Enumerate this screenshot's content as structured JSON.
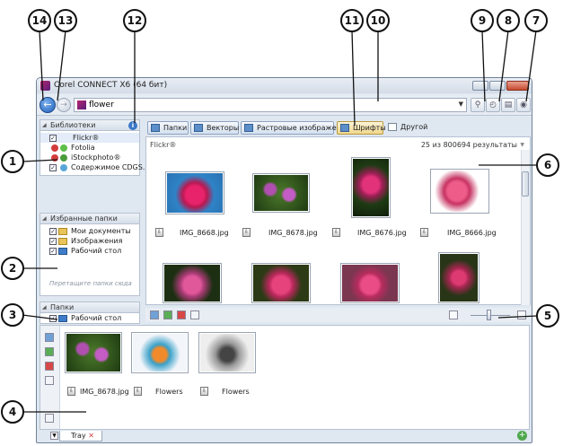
{
  "window": {
    "title": "Corel CONNECT X6 (64 бит)"
  },
  "address_bar": {
    "search_value": "flower"
  },
  "libraries": {
    "header": "Библиотеки",
    "items": [
      {
        "label": "Flickr®",
        "checked": true
      },
      {
        "label": "Fotolia",
        "checked": false
      },
      {
        "label": "iStockphoto®",
        "checked": false
      },
      {
        "label": "Содержимое CDGS...",
        "checked": true
      }
    ]
  },
  "favorites": {
    "header": "Избранные папки",
    "items": [
      {
        "label": "Мои документы"
      },
      {
        "label": "Изображения"
      },
      {
        "label": "Рабочий стол"
      }
    ],
    "hint": "Перетащите папки сюда"
  },
  "folders": {
    "header": "Папки",
    "items": [
      {
        "label": "Рабочий стол"
      }
    ]
  },
  "tabs": [
    {
      "label": "Папки"
    },
    {
      "label": "Векторы"
    },
    {
      "label": "Растровые изображения"
    },
    {
      "label": "Шрифты",
      "active": true
    },
    {
      "label": "Другой"
    }
  ],
  "content": {
    "source": "Flickr®",
    "count": "25 из 800694 результаты",
    "files": [
      "IMG_8668.jpg",
      "IMG_8678.jpg",
      "IMG_8676.jpg",
      "IMG_8666.jpg"
    ]
  },
  "tray": {
    "tab_label": "Tray",
    "files": [
      "IMG_8678.jpg",
      "Flowers",
      "Flowers"
    ]
  },
  "callouts": [
    "14",
    "13",
    "12",
    "11",
    "10",
    "9",
    "8",
    "7",
    "1",
    "2",
    "3",
    "4",
    "5",
    "6"
  ],
  "colors": {
    "accent": "#3a78c8",
    "window_bg": "#dfe7f1",
    "active_tab": "#f0d78a"
  }
}
